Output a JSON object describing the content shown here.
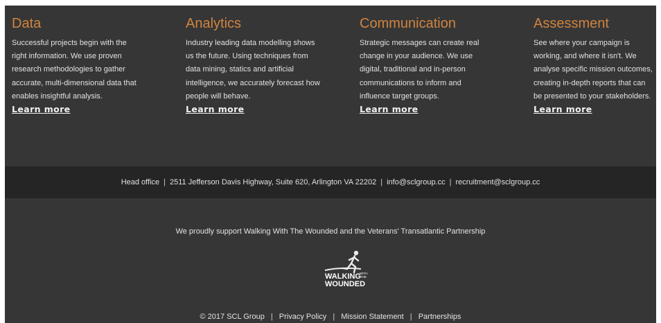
{
  "columns": [
    {
      "title": "Data",
      "text": "Successful projects begin with the right information. We use proven research methodologies to gather accurate, multi-dimensional data that enables insightful analysis.",
      "link": "Learn more"
    },
    {
      "title": "Analytics",
      "text": "Industry leading data modelling shows us the future. Using techniques from data mining, statics and artificial intelligence, we accurately forecast how people will behave.",
      "link": "Learn more"
    },
    {
      "title": "Communication",
      "text": "Strategic messages can create real change in your audience. We use digital, traditional and in-person communications to inform and influence target groups.",
      "link": "Learn more"
    },
    {
      "title": "Assessment",
      "text": "See where your campaign is working, and where it isn't. We analyse specific mission outcomes, creating in-depth reports that can be presented to your stakeholders.",
      "link": "Learn more"
    }
  ],
  "contact": {
    "office_label": "Head office",
    "address": "2511 Jefferson Davis Highway, Suite 620, Arlington VA 22202",
    "email_info": "info@sclgroup.cc",
    "email_recruitment": "recruitment@sclgroup.cc",
    "separator": "|"
  },
  "support": {
    "text": "We proudly support Walking With The Wounded and the Veterans' Transatlantic Partnership",
    "logo_line1": "WALKING",
    "logo_with": "WITH",
    "logo_the": "THE",
    "logo_line2": "WOUNDED"
  },
  "legal": {
    "copyright": "© 2017 SCL Group",
    "privacy": "Privacy Policy",
    "mission": "Mission Statement",
    "partnerships": "Partnerships",
    "separator": "|"
  },
  "colors": {
    "background": "#363636",
    "contact_bar": "#252525",
    "heading_accent": "#d1843f"
  }
}
